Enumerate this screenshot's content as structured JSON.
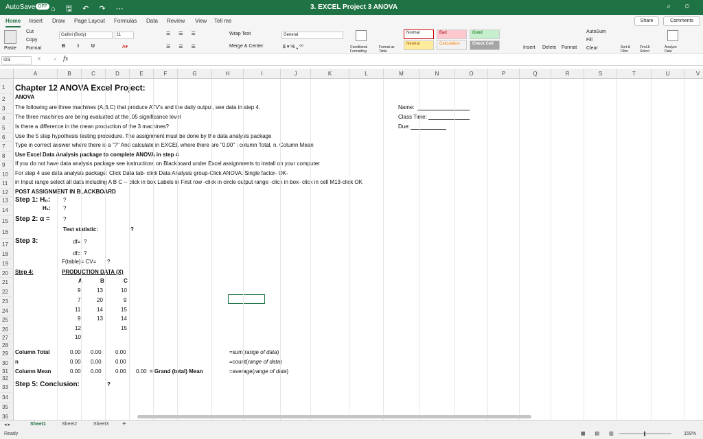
{
  "titlebar": {
    "autosave": "AutoSave",
    "off": "OFF",
    "qat": "⌂ 🖫 ↶ ↷ ⋯",
    "doc_icon": "excel-file-icon",
    "title": "3. EXCEL Project 3 ANOVA",
    "right": "⌕ ☺"
  },
  "menu": {
    "tabs": [
      "Home",
      "Insert",
      "Draw",
      "Page Layout",
      "Formulas",
      "Data",
      "Review",
      "View",
      "Tell me"
    ],
    "share": "Share",
    "comments": "Comments"
  },
  "ribbon": {
    "paste": "Paste",
    "cut": "Cut",
    "copy": "Copy",
    "format": "Format",
    "font_name": "Calibri (Body)",
    "font_size": "11",
    "wrap": "Wrap Text",
    "merge": "Merge & Center",
    "number_format": "General",
    "cond": "Conditional Formatting",
    "fmt_table": "Format as Table",
    "styles": [
      {
        "label": "Normal",
        "color": "#ffffff"
      },
      {
        "label": "Bad",
        "color": "#ffc7ce"
      },
      {
        "label": "Good",
        "color": "#c6efce"
      },
      {
        "label": "Neutral",
        "color": "#ffeb9c"
      },
      {
        "label": "Calculation",
        "color": "#f2f2f2"
      },
      {
        "label": "Check Cell",
        "color": "#a5a5a5"
      }
    ],
    "insert": "Insert",
    "delete": "Delete",
    "format_cells": "Format",
    "autosum": "AutoSum",
    "fill": "Fill",
    "clear": "Clear",
    "sort": "Sort & Filter",
    "find": "Find & Select",
    "analyze": "Analyze Data"
  },
  "formula": {
    "namebox": "I23",
    "fx": "fx",
    "value": ""
  },
  "columns": [
    "A",
    "B",
    "C",
    "D",
    "E",
    "F",
    "G",
    "H",
    "I",
    "J",
    "K",
    "L",
    "M",
    "N",
    "O",
    "P",
    "Q",
    "R",
    "S",
    "T",
    "U",
    "V"
  ],
  "rows": [
    "1",
    "2",
    "3",
    "4",
    "5",
    "6",
    "7",
    "8",
    "9",
    "10",
    "11",
    "12",
    "13",
    "14",
    "15",
    "16",
    "17",
    "18",
    "19",
    "20",
    "21",
    "22",
    "23",
    "24",
    "25",
    "26",
    "27",
    "28",
    "29",
    "30",
    "31",
    "32",
    "33",
    "34",
    "35",
    "36"
  ],
  "cells": {
    "r1": "Chapter 12 ANOVA Excel Project:",
    "r2": "ANOVA",
    "r3": "The following are three machines (A,B,C) that produce ATV's and the daily output, see data in step 4.",
    "r4": "The three machines are being evaluated at the .05 significance level",
    "r5": "Is there a difference in the mean production of the 3 machines?",
    "r6": "Use the 5 step hypothesis testing procedure. The assignment must be done by the data analysis package",
    "r7": "Type in correct answer where there is a \"?\" And calculate in EXCEL where there are \"0.00\" : column Total, n, Column Mean",
    "r8": "Use Excel Data Analysis package to complete ANOVA in step 4",
    "r9": "If you do not have data analysis package see instructions on Blackboard under Excel assignments to install on your computer",
    "r10": "For step 4 use data analysis package: Click Data tab- click Data Analysis group-Click  ANOVA: Single factor- OK-",
    "r11": "in Input range select all data including A B C -- click in box  Labels in First row -click in circle output range -click in box- click in cell M13-click OK",
    "r12": "POST ASSIGNMENT IN BLACKBOARD",
    "name": "Name:",
    "class_time": "Class Time:",
    "due": "Due:",
    "step1": "Step 1: H₀:",
    "h1": "H₁:",
    "q": "?",
    "step2": "Step 2: α =",
    "test_stat": "Test statistic:",
    "step3": "Step 3:",
    "df": "df=",
    "fcv": "F(table)= CV=",
    "step4": "Step 4:",
    "prod": "PRODUCTION DATA (X)",
    "colA": "A",
    "colB": "B",
    "colC": "C",
    "dataA": [
      "9",
      "7",
      "11",
      "9",
      "12",
      "10"
    ],
    "dataB": [
      "13",
      "20",
      "14",
      "13"
    ],
    "dataC": [
      "10",
      "9",
      "15",
      "14",
      "15"
    ],
    "col_total": "Column Total",
    "n": "n",
    "col_mean": "Column Mean",
    "zero": "0.00",
    "grand": "= Grand (total) Mean",
    "f_sum": "=sum(",
    "f_sum_i": "range of data",
    "f_cnt": "=count(",
    "f_cnt_i": "range of data",
    "f_avg": "=average(",
    "f_avg_i": "range of data",
    "close": ")",
    "step5": "Step 5: Conclusion:"
  },
  "sheets": [
    "Sheet1",
    "Sheet2",
    "Sheet3"
  ],
  "status": {
    "ready": "Ready",
    "zoom": "159%",
    "plus": "+"
  }
}
